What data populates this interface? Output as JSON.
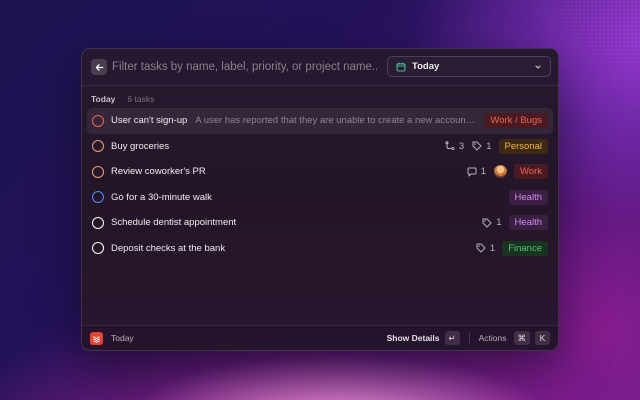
{
  "search": {
    "placeholder": "Filter tasks by name, label, priority, or project name..."
  },
  "filter": {
    "selected": "Today",
    "icon": "calendar-icon"
  },
  "section": {
    "title": "Today",
    "count": "6 tasks"
  },
  "tasks": [
    {
      "title": "User can't sign-up",
      "description": "A user has reported that they are unable to create a new account on th...",
      "tag": "Work / Bugs",
      "tag_color": "#f0644f",
      "tag_bg": "#4a1a22",
      "priority_color": "#f0644f",
      "selected": true
    },
    {
      "title": "Buy groceries",
      "subtasks": "3",
      "labels": "1",
      "tag": "Personal",
      "tag_color": "#f5b43a",
      "tag_bg": "#3d2a15",
      "priority_color": "#f0a070"
    },
    {
      "title": "Review coworker's PR",
      "comments": "1",
      "tag": "Work",
      "tag_color": "#f0644f",
      "tag_bg": "#4a1a22",
      "priority_color": "#f0a070"
    },
    {
      "title": "Go for a 30-minute walk",
      "tag": "Health",
      "tag_color": "#d28ae8",
      "tag_bg": "#3a1f45",
      "priority_color": "#4e8ef7"
    },
    {
      "title": "Schedule dentist appointment",
      "labels": "1",
      "tag": "Health",
      "tag_color": "#d28ae8",
      "tag_bg": "#3a1f45",
      "priority_color": "#ffffff"
    },
    {
      "title": "Deposit checks at the bank",
      "labels": "1",
      "tag": "Finance",
      "tag_color": "#4cc76a",
      "tag_bg": "#193222",
      "priority_color": "#ffffff"
    }
  ],
  "footer": {
    "title": "Today",
    "show_details": "Show Details",
    "enter_key": "↵",
    "actions": "Actions",
    "cmd_key": "⌘",
    "k_key": "K"
  }
}
